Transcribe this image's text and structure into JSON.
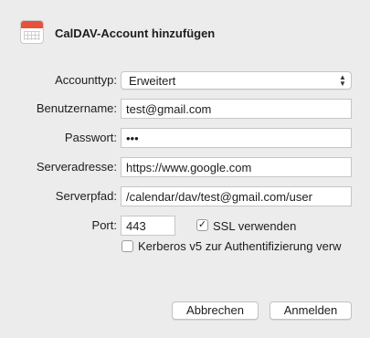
{
  "dialog": {
    "title": "CalDAV-Account hinzufügen"
  },
  "form": {
    "account_type": {
      "label": "Accounttyp:",
      "value": "Erweitert"
    },
    "username": {
      "label": "Benutzername:",
      "value": "test@gmail.com"
    },
    "password": {
      "label": "Passwort:",
      "value": "•••"
    },
    "server_address": {
      "label": "Serveradresse:",
      "value": "https://www.google.com"
    },
    "server_path": {
      "label": "Serverpfad:",
      "value": "/calendar/dav/test@gmail.com/user"
    },
    "port": {
      "label": "Port:",
      "value": "443"
    },
    "ssl": {
      "label": "SSL verwenden",
      "checked": true
    },
    "kerberos": {
      "label": "Kerberos v5 zur Authentifizierung verw",
      "checked": false
    }
  },
  "buttons": {
    "cancel_label": "Abbrechen",
    "signin_label": "Anmelden"
  },
  "icons": {
    "app": "calendar-icon",
    "popup": "up-down-chevron-icon",
    "checkmark": "checkmark-icon"
  },
  "colors": {
    "window_bg": "#ececec",
    "calendar_red": "#e5533d"
  }
}
